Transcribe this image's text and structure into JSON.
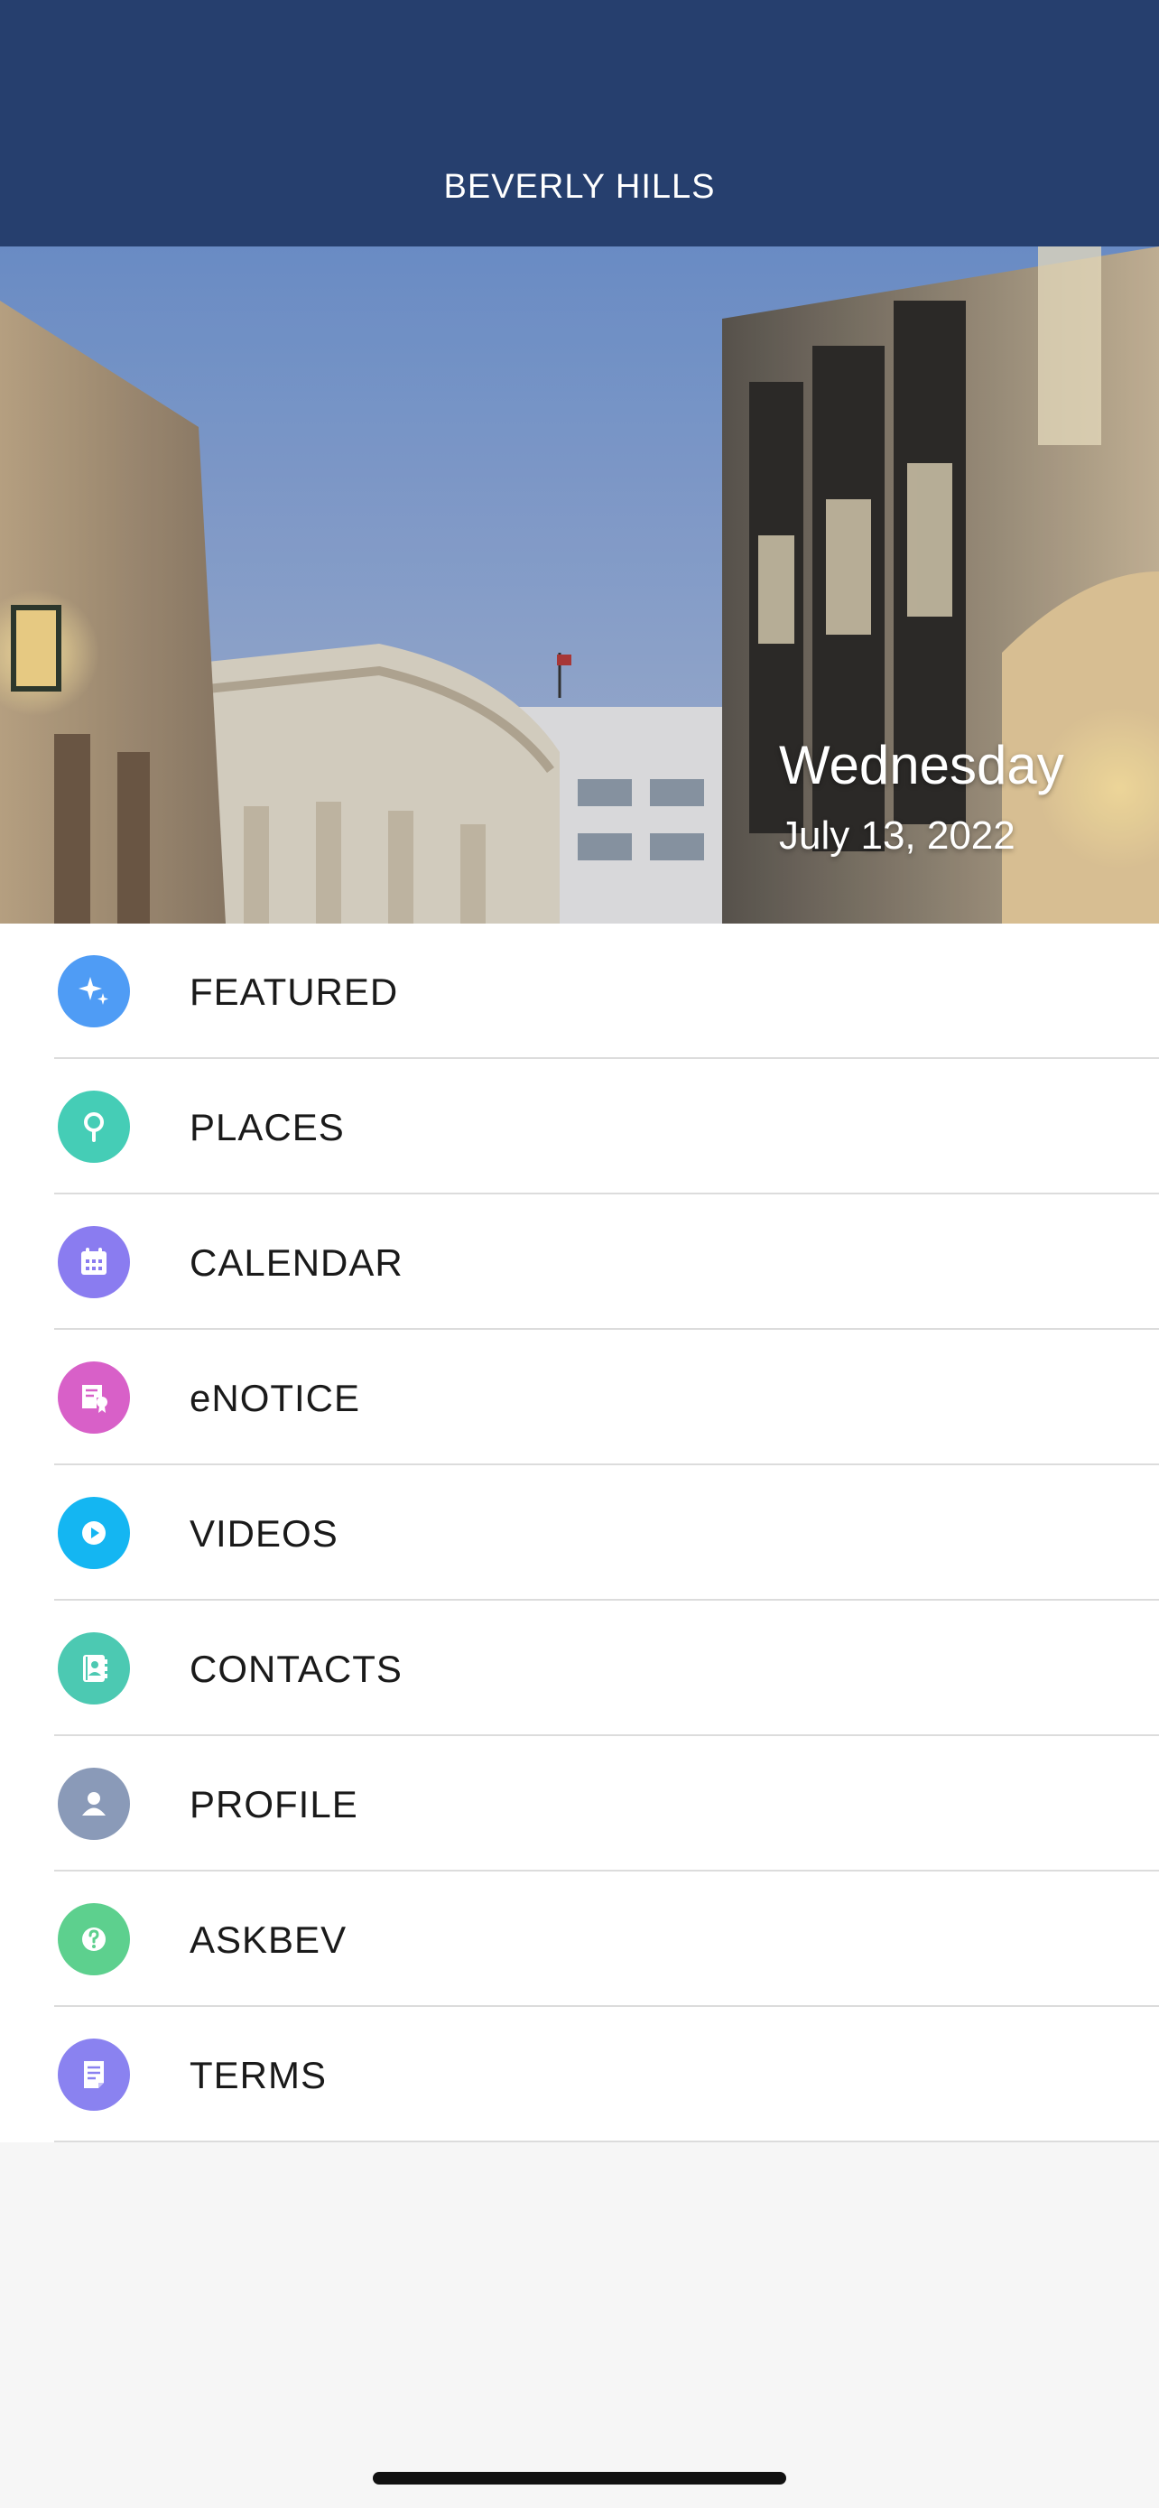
{
  "header": {
    "title": "BEVERLY HILLS"
  },
  "hero": {
    "day": "Wednesday",
    "date": "July 13, 2022"
  },
  "menu": {
    "items": [
      {
        "label": "FEATURED",
        "icon": "sparkle-icon",
        "color": "#4f9cf5"
      },
      {
        "label": "PLACES",
        "icon": "map-pin-icon",
        "color": "#45cdb6"
      },
      {
        "label": "CALENDAR",
        "icon": "calendar-icon",
        "color": "#8a7cf0"
      },
      {
        "label": "eNOTICE",
        "icon": "certificate-icon",
        "color": "#d860c8"
      },
      {
        "label": "VIDEOS",
        "icon": "play-icon",
        "color": "#14b6f2"
      },
      {
        "label": "CONTACTS",
        "icon": "address-book-icon",
        "color": "#4cc9b2"
      },
      {
        "label": "PROFILE",
        "icon": "person-icon",
        "color": "#8a9ab8"
      },
      {
        "label": "ASKBEV",
        "icon": "question-icon",
        "color": "#5dd08e"
      },
      {
        "label": "TERMS",
        "icon": "document-icon",
        "color": "#8a82f0"
      }
    ]
  }
}
